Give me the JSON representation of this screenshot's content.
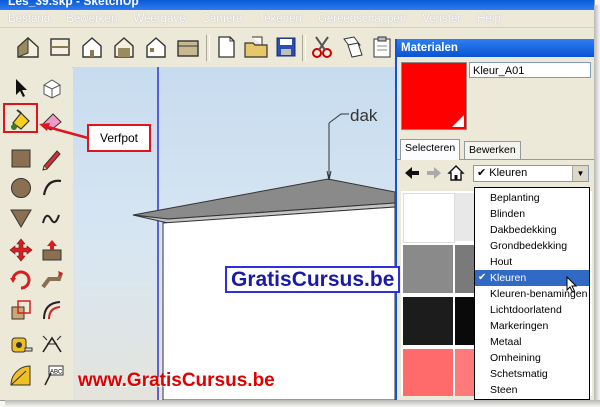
{
  "window": {
    "title": "Les_39.skp - SketchUp"
  },
  "menu": {
    "items": [
      "Bestand",
      "Bewerken",
      "Weergave",
      "Camera",
      "Tekenen",
      "Gereedschappen",
      "Venster",
      "Help"
    ]
  },
  "materials_panel": {
    "title": "Materialen",
    "material_name": "Kleur_A01",
    "swatch_color": "#ff0000",
    "tabs": [
      "Selecteren",
      "Bewerken"
    ],
    "collection_selected": "Kleuren",
    "dropdown_options": [
      "Beplanting",
      "Blinden",
      "Dakbedekking",
      "Grondbedekking",
      "Hout",
      "Kleuren",
      "Kleuren-benamingen",
      "Lichtdoorlatend",
      "Markeringen",
      "Metaal",
      "Omheining",
      "Schetsmatig",
      "Steen"
    ],
    "grid_colors": [
      "#ffffff",
      "#e8e8e8",
      "#8a8a8a",
      "#7a7a7a",
      "#1c1c1c",
      "#0a0a0a",
      "#ff6b6b",
      "#ff7a7a"
    ]
  },
  "annotations": {
    "callout": "Verfpot",
    "model_label": "dak",
    "brand_banner": "GratisCursus.be",
    "watermark": "www.GratisCursus.be"
  },
  "colors": {
    "accent_blue": "#0a52d2",
    "highlight_red": "#e0141e",
    "selection_blue": "#316ac5"
  }
}
